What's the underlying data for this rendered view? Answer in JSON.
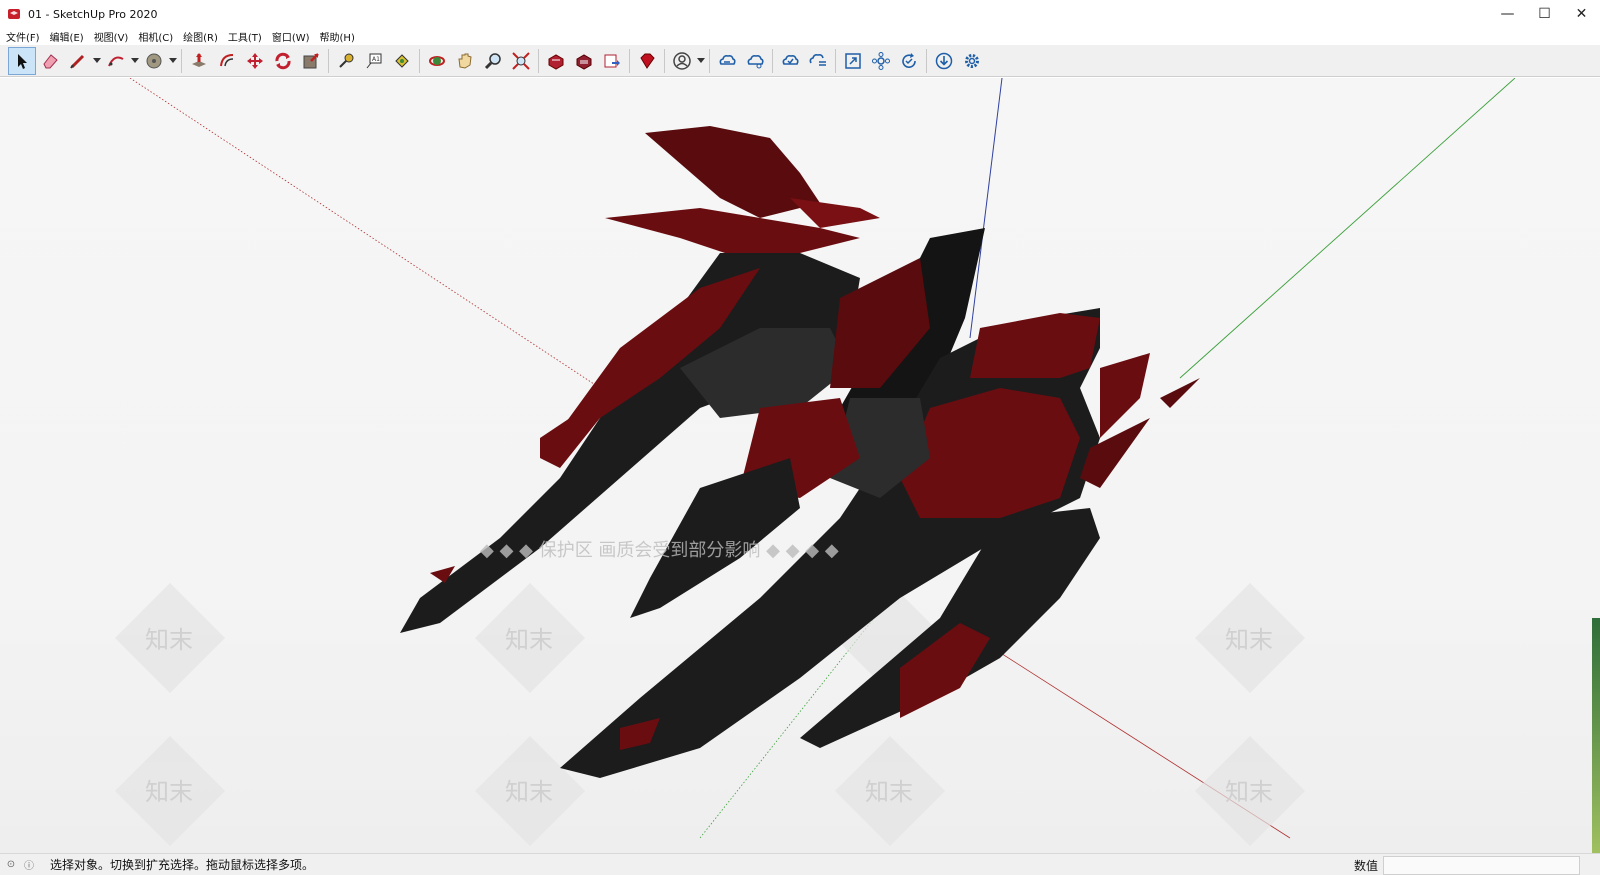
{
  "window": {
    "title": "01 - SketchUp Pro 2020",
    "controls": [
      "—",
      "☐",
      "✕"
    ]
  },
  "menu": [
    "文件(F)",
    "编辑(E)",
    "视图(V)",
    "相机(C)",
    "绘图(R)",
    "工具(T)",
    "窗口(W)",
    "帮助(H)"
  ],
  "toolbar": {
    "tools": [
      {
        "name": "select-icon",
        "active": true
      },
      {
        "name": "eraser-icon"
      },
      {
        "name": "line-icon",
        "dropdown": true
      },
      {
        "name": "arc-icon",
        "dropdown": true
      },
      {
        "name": "shape-icon",
        "dropdown": true
      },
      {
        "name": "push-pull-icon"
      },
      {
        "name": "offset-icon"
      },
      {
        "name": "move-icon"
      },
      {
        "name": "rotate-icon"
      },
      {
        "name": "scale-icon"
      },
      {
        "name": "tape-measure-icon"
      },
      {
        "name": "text-icon"
      },
      {
        "name": "paint-bucket-icon"
      },
      {
        "name": "orbit-icon"
      },
      {
        "name": "pan-icon"
      },
      {
        "name": "zoom-icon"
      },
      {
        "name": "zoom-extents-icon"
      },
      {
        "name": "warehouse-icon"
      },
      {
        "name": "extension-warehouse-icon"
      },
      {
        "name": "layout-send-icon"
      },
      {
        "name": "ruby-icon"
      },
      {
        "name": "account-icon",
        "dropdown": true
      },
      {
        "name": "cloud-sync-icon"
      },
      {
        "name": "cloud-share-icon"
      },
      {
        "name": "cloud-check-icon"
      },
      {
        "name": "cloud-list-icon"
      },
      {
        "name": "fullscreen-icon"
      },
      {
        "name": "components-icon"
      },
      {
        "name": "refresh-check-icon"
      },
      {
        "name": "download-icon"
      },
      {
        "name": "settings-icon"
      }
    ]
  },
  "viewport": {
    "watermark_banner": "◆ ◆ ◆ 保护区 画质会受到部分影响 ◆ ◆ ◆ ◆",
    "watermark_mark": "知末",
    "model_colors": {
      "red": "#6a0d10",
      "dark": "#1c1c1c",
      "mid": "#2c2c2c"
    },
    "axis_colors": {
      "blue": "#3040a0",
      "green": "#3aa03a",
      "red": "#b03030"
    }
  },
  "statusbar": {
    "message": "选择对象。切换到扩充选择。拖动鼠标选择多项。",
    "measure_label": "数值",
    "measure_value": ""
  }
}
